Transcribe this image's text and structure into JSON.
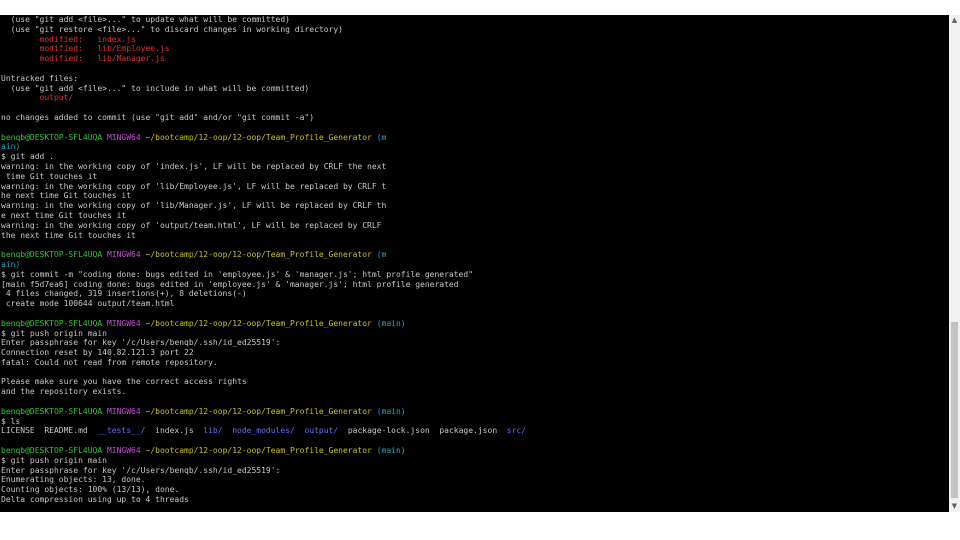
{
  "terminal": {
    "colors": {
      "background": "#000000",
      "white": "#c8c8c8",
      "red": "#e2322c",
      "green": "#34c23a",
      "magenta": "#c14ecf",
      "yellow": "#c7c025",
      "cyan": "#1fa9c9",
      "blue": "#5973ff"
    },
    "lines": [
      [
        [
          "white",
          "  (use \"git add <file>...\" to update what will be committed)"
        ]
      ],
      [
        [
          "white",
          "  (use \"git restore <file>...\" to discard changes in working directory)"
        ]
      ],
      [
        [
          "red",
          "        modified:   index.js"
        ]
      ],
      [
        [
          "red",
          "        modified:   lib/Employee.js"
        ]
      ],
      [
        [
          "red",
          "        modified:   lib/Manager.js"
        ]
      ],
      [],
      [
        [
          "white",
          "Untracked files:"
        ]
      ],
      [
        [
          "white",
          "  (use \"git add <file>...\" to include in what will be committed)"
        ]
      ],
      [
        [
          "red",
          "        output/"
        ]
      ],
      [],
      [
        [
          "white",
          "no changes added to commit (use \"git add\" and/or \"git commit -a\")"
        ]
      ],
      [],
      [
        [
          "green",
          "benqb@DESKTOP-SFL4UQA "
        ],
        [
          "magenta",
          "MINGW64 "
        ],
        [
          "yellow",
          "~/bootcamp/12-oop/12-oop/Team_Profile_Generator"
        ],
        [
          "cyan",
          " (m"
        ]
      ],
      [
        [
          "cyan",
          "ain)"
        ]
      ],
      [
        [
          "white",
          "$ git add ."
        ]
      ],
      [
        [
          "white",
          "warning: in the working copy of 'index.js', LF will be replaced by CRLF the next"
        ]
      ],
      [
        [
          "white",
          " time Git touches it"
        ]
      ],
      [
        [
          "white",
          "warning: in the working copy of 'lib/Employee.js', LF will be replaced by CRLF t"
        ]
      ],
      [
        [
          "white",
          "he next time Git touches it"
        ]
      ],
      [
        [
          "white",
          "warning: in the working copy of 'lib/Manager.js', LF will be replaced by CRLF th"
        ]
      ],
      [
        [
          "white",
          "e next time Git touches it"
        ]
      ],
      [
        [
          "white",
          "warning: in the working copy of 'output/team.html', LF will be replaced by CRLF"
        ]
      ],
      [
        [
          "white",
          "the next time Git touches it"
        ]
      ],
      [],
      [
        [
          "green",
          "benqb@DESKTOP-SFL4UQA "
        ],
        [
          "magenta",
          "MINGW64 "
        ],
        [
          "yellow",
          "~/bootcamp/12-oop/12-oop/Team_Profile_Generator"
        ],
        [
          "cyan",
          " (m"
        ]
      ],
      [
        [
          "cyan",
          "ain)"
        ]
      ],
      [
        [
          "white",
          "$ git commit -m \"coding done: bugs edited in 'employee.js' & 'manager.js'; html profile generated\""
        ]
      ],
      [
        [
          "white",
          "[main f5d7ea6] coding done: bugs edited in 'employee.js' & 'manager.js'; html profile generated"
        ]
      ],
      [
        [
          "white",
          " 4 files changed, 319 insertions(+), 8 deletions(-)"
        ]
      ],
      [
        [
          "white",
          " create mode 100644 output/team.html"
        ]
      ],
      [],
      [
        [
          "green",
          "benqb@DESKTOP-SFL4UQA "
        ],
        [
          "magenta",
          "MINGW64 "
        ],
        [
          "yellow",
          "~/bootcamp/12-oop/12-oop/Team_Profile_Generator"
        ],
        [
          "cyan",
          " (main)"
        ]
      ],
      [
        [
          "white",
          "$ git push origin main"
        ]
      ],
      [
        [
          "white",
          "Enter passphrase for key '/c/Users/benqb/.ssh/id_ed25519':"
        ]
      ],
      [
        [
          "white",
          "Connection reset by 140.82.121.3 port 22"
        ]
      ],
      [
        [
          "white",
          "fatal: Could not read from remote repository."
        ]
      ],
      [],
      [
        [
          "white",
          "Please make sure you have the correct access rights"
        ]
      ],
      [
        [
          "white",
          "and the repository exists."
        ]
      ],
      [],
      [
        [
          "green",
          "benqb@DESKTOP-SFL4UQA "
        ],
        [
          "magenta",
          "MINGW64 "
        ],
        [
          "yellow",
          "~/bootcamp/12-oop/12-oop/Team_Profile_Generator"
        ],
        [
          "cyan",
          " (main)"
        ]
      ],
      [
        [
          "white",
          "$ ls"
        ]
      ],
      [
        [
          "white",
          "LICENSE  README.md  "
        ],
        [
          "blue",
          "__tests__/"
        ],
        [
          "white",
          "  index.js  "
        ],
        [
          "blue",
          "lib/"
        ],
        [
          "white",
          "  "
        ],
        [
          "blue",
          "node_modules/"
        ],
        [
          "white",
          "  "
        ],
        [
          "blue",
          "output/"
        ],
        [
          "white",
          "  package-lock.json  package.json  "
        ],
        [
          "blue",
          "src/"
        ]
      ],
      [],
      [
        [
          "green",
          "benqb@DESKTOP-SFL4UQA "
        ],
        [
          "magenta",
          "MINGW64 "
        ],
        [
          "yellow",
          "~/bootcamp/12-oop/12-oop/Team_Profile_Generator"
        ],
        [
          "cyan",
          " (main)"
        ]
      ],
      [
        [
          "white",
          "$ git push origin main"
        ]
      ],
      [
        [
          "white",
          "Enter passphrase for key '/c/Users/benqb/.ssh/id_ed25519':"
        ]
      ],
      [
        [
          "white",
          "Enumerating objects: 13, done."
        ]
      ],
      [
        [
          "white",
          "Counting objects: 100% (13/13), done."
        ]
      ],
      [
        [
          "white",
          "Delta compression using up to 4 threads"
        ]
      ]
    ]
  },
  "scrollbar": {
    "up_icon": "chevron-up-icon",
    "down_icon": "chevron-down-icon",
    "up_glyph": "▲",
    "down_glyph": "▼"
  }
}
